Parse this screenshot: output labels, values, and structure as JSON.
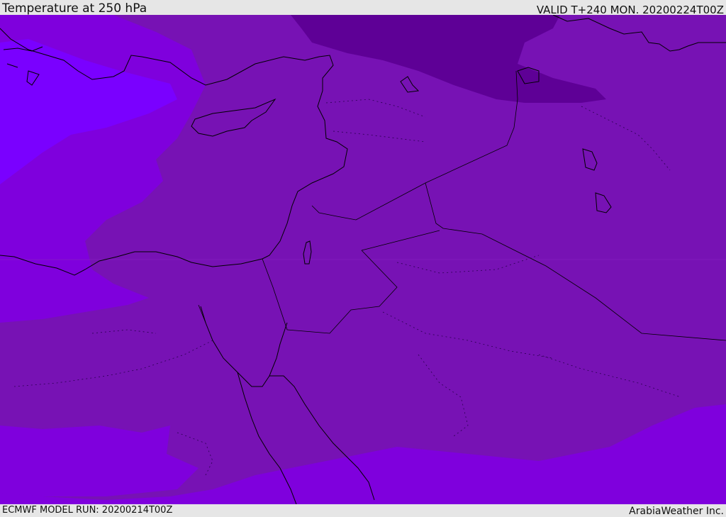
{
  "header": {
    "title": "Temperature at 250 hPa",
    "valid": "VALID T+240 MON. 20200224T00Z"
  },
  "footer": {
    "model_run": "ECMWF MODEL RUN: 20200214T00Z",
    "credit": "ArabiaWeather Inc."
  },
  "map": {
    "field": "temperature",
    "level": "250 hPa",
    "colors": {
      "warmest_west": "#7a00ff",
      "warm": "#7f00dd",
      "mid": "#7712b4",
      "cold": "#5e0096",
      "coast_line": "#000000",
      "border_line": "#000000"
    }
  }
}
